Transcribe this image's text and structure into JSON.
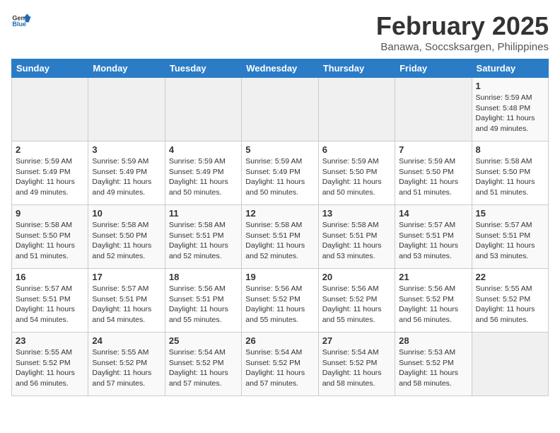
{
  "header": {
    "logo_general": "General",
    "logo_blue": "Blue",
    "title": "February 2025",
    "subtitle": "Banawa, Soccsksargen, Philippines"
  },
  "weekdays": [
    "Sunday",
    "Monday",
    "Tuesday",
    "Wednesday",
    "Thursday",
    "Friday",
    "Saturday"
  ],
  "weeks": [
    [
      {
        "day": "",
        "info": ""
      },
      {
        "day": "",
        "info": ""
      },
      {
        "day": "",
        "info": ""
      },
      {
        "day": "",
        "info": ""
      },
      {
        "day": "",
        "info": ""
      },
      {
        "day": "",
        "info": ""
      },
      {
        "day": "1",
        "info": "Sunrise: 5:59 AM\nSunset: 5:48 PM\nDaylight: 11 hours\nand 49 minutes."
      }
    ],
    [
      {
        "day": "2",
        "info": "Sunrise: 5:59 AM\nSunset: 5:49 PM\nDaylight: 11 hours\nand 49 minutes."
      },
      {
        "day": "3",
        "info": "Sunrise: 5:59 AM\nSunset: 5:49 PM\nDaylight: 11 hours\nand 49 minutes."
      },
      {
        "day": "4",
        "info": "Sunrise: 5:59 AM\nSunset: 5:49 PM\nDaylight: 11 hours\nand 50 minutes."
      },
      {
        "day": "5",
        "info": "Sunrise: 5:59 AM\nSunset: 5:49 PM\nDaylight: 11 hours\nand 50 minutes."
      },
      {
        "day": "6",
        "info": "Sunrise: 5:59 AM\nSunset: 5:50 PM\nDaylight: 11 hours\nand 50 minutes."
      },
      {
        "day": "7",
        "info": "Sunrise: 5:59 AM\nSunset: 5:50 PM\nDaylight: 11 hours\nand 51 minutes."
      },
      {
        "day": "8",
        "info": "Sunrise: 5:58 AM\nSunset: 5:50 PM\nDaylight: 11 hours\nand 51 minutes."
      }
    ],
    [
      {
        "day": "9",
        "info": "Sunrise: 5:58 AM\nSunset: 5:50 PM\nDaylight: 11 hours\nand 51 minutes."
      },
      {
        "day": "10",
        "info": "Sunrise: 5:58 AM\nSunset: 5:50 PM\nDaylight: 11 hours\nand 52 minutes."
      },
      {
        "day": "11",
        "info": "Sunrise: 5:58 AM\nSunset: 5:51 PM\nDaylight: 11 hours\nand 52 minutes."
      },
      {
        "day": "12",
        "info": "Sunrise: 5:58 AM\nSunset: 5:51 PM\nDaylight: 11 hours\nand 52 minutes."
      },
      {
        "day": "13",
        "info": "Sunrise: 5:58 AM\nSunset: 5:51 PM\nDaylight: 11 hours\nand 53 minutes."
      },
      {
        "day": "14",
        "info": "Sunrise: 5:57 AM\nSunset: 5:51 PM\nDaylight: 11 hours\nand 53 minutes."
      },
      {
        "day": "15",
        "info": "Sunrise: 5:57 AM\nSunset: 5:51 PM\nDaylight: 11 hours\nand 53 minutes."
      }
    ],
    [
      {
        "day": "16",
        "info": "Sunrise: 5:57 AM\nSunset: 5:51 PM\nDaylight: 11 hours\nand 54 minutes."
      },
      {
        "day": "17",
        "info": "Sunrise: 5:57 AM\nSunset: 5:51 PM\nDaylight: 11 hours\nand 54 minutes."
      },
      {
        "day": "18",
        "info": "Sunrise: 5:56 AM\nSunset: 5:51 PM\nDaylight: 11 hours\nand 55 minutes."
      },
      {
        "day": "19",
        "info": "Sunrise: 5:56 AM\nSunset: 5:52 PM\nDaylight: 11 hours\nand 55 minutes."
      },
      {
        "day": "20",
        "info": "Sunrise: 5:56 AM\nSunset: 5:52 PM\nDaylight: 11 hours\nand 55 minutes."
      },
      {
        "day": "21",
        "info": "Sunrise: 5:56 AM\nSunset: 5:52 PM\nDaylight: 11 hours\nand 56 minutes."
      },
      {
        "day": "22",
        "info": "Sunrise: 5:55 AM\nSunset: 5:52 PM\nDaylight: 11 hours\nand 56 minutes."
      }
    ],
    [
      {
        "day": "23",
        "info": "Sunrise: 5:55 AM\nSunset: 5:52 PM\nDaylight: 11 hours\nand 56 minutes."
      },
      {
        "day": "24",
        "info": "Sunrise: 5:55 AM\nSunset: 5:52 PM\nDaylight: 11 hours\nand 57 minutes."
      },
      {
        "day": "25",
        "info": "Sunrise: 5:54 AM\nSunset: 5:52 PM\nDaylight: 11 hours\nand 57 minutes."
      },
      {
        "day": "26",
        "info": "Sunrise: 5:54 AM\nSunset: 5:52 PM\nDaylight: 11 hours\nand 57 minutes."
      },
      {
        "day": "27",
        "info": "Sunrise: 5:54 AM\nSunset: 5:52 PM\nDaylight: 11 hours\nand 58 minutes."
      },
      {
        "day": "28",
        "info": "Sunrise: 5:53 AM\nSunset: 5:52 PM\nDaylight: 11 hours\nand 58 minutes."
      },
      {
        "day": "",
        "info": ""
      }
    ]
  ]
}
